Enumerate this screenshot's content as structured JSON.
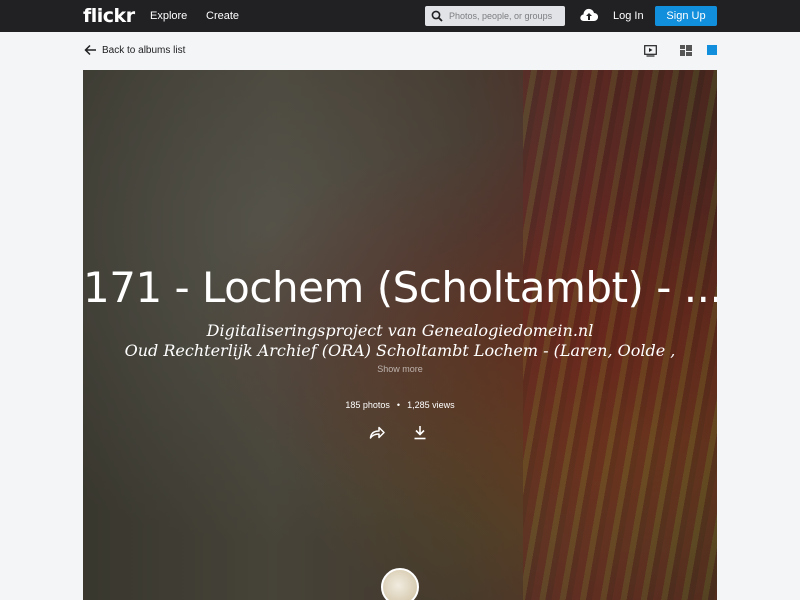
{
  "nav": {
    "logo": "flickr",
    "explore": "Explore",
    "create": "Create",
    "search_placeholder": "Photos, people, or groups",
    "login": "Log In",
    "signup": "Sign Up"
  },
  "subnav": {
    "back": "Back to albums list"
  },
  "album": {
    "title": "171 - Lochem (Scholtambt) - ...",
    "description_line1": "Digitaliseringsproject van Genealogiedomein.nl",
    "description_line2": "Oud Rechterlijk Archief (ORA) Scholtambt Lochem - (Laren, Oolde ,",
    "show_more": "Show more",
    "photos": "185 photos",
    "separator": "•",
    "views": "1,285 views"
  },
  "colors": {
    "topbar": "#212124",
    "accent": "#128fdc",
    "page_bg": "#f3f5f6"
  },
  "icons": [
    "search-icon",
    "upload-cloud-icon",
    "back-arrow-icon",
    "slideshow-icon",
    "grid-view-icon",
    "single-view-icon",
    "share-icon",
    "download-icon"
  ]
}
